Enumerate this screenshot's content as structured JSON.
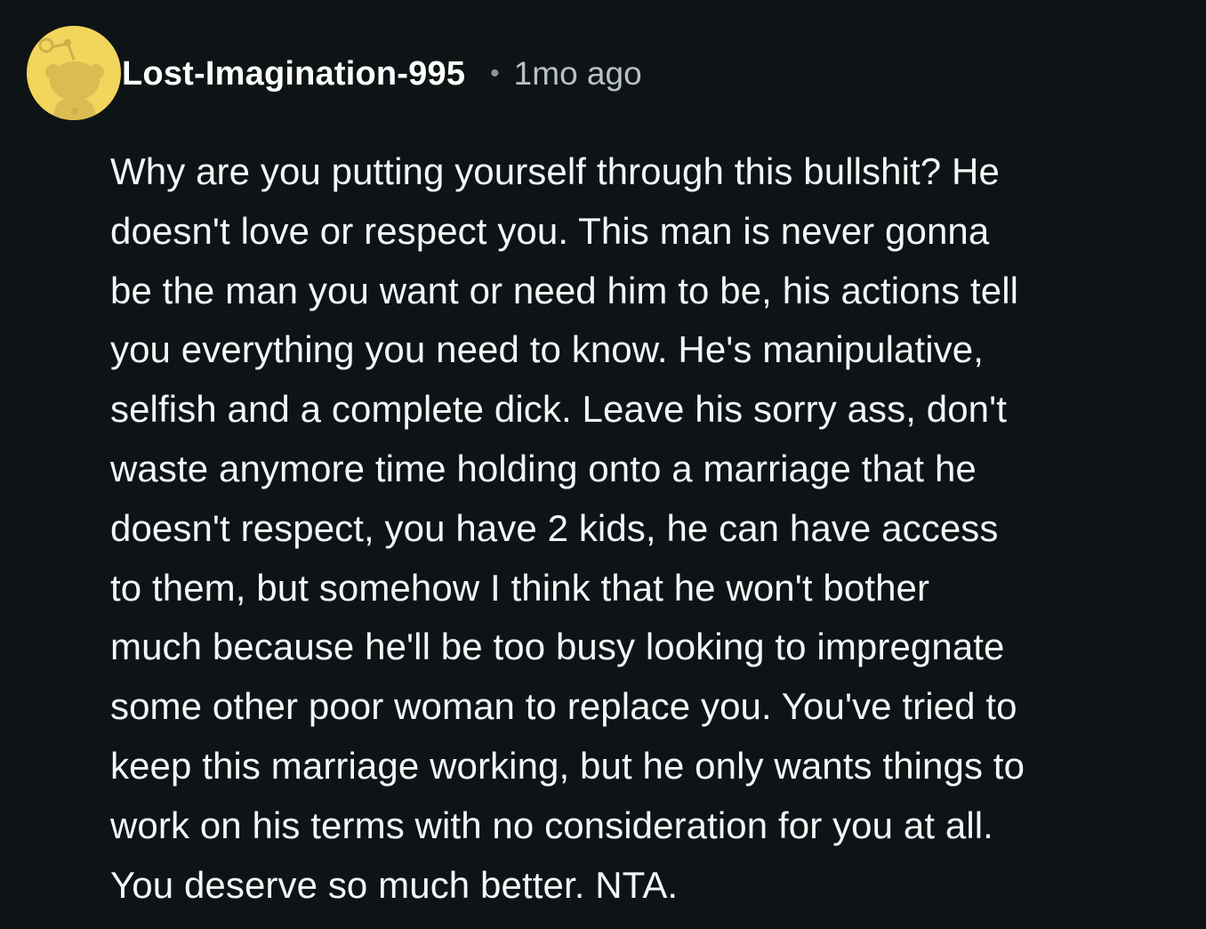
{
  "comment": {
    "username": "Lost-Imagination-995",
    "separator": "•",
    "timestamp": "1mo ago",
    "avatar_icon": "reddit-snoo-avatar-icon",
    "avatar_color": "#f2d55c",
    "body_lines": [
      "Why are you putting yourself through this bullshit? He",
      "doesn't love or respect you. This man is never gonna",
      "be the man you want or need him to be, his actions tell",
      "you everything you need to know. He's manipulative,",
      "selfish and a complete dick. Leave his sorry ass, don't",
      "waste anymore time holding onto a marriage that he",
      "doesn't respect, you have 2 kids, he can have access",
      "to them, but somehow I think that he won't bother",
      "much because he'll be too busy looking to impregnate",
      "some other poor woman to replace you. You've tried to",
      "keep this marriage working, but he only wants things to",
      "work on his terms with no consideration for you at all.",
      "You deserve so much better. NTA."
    ]
  }
}
